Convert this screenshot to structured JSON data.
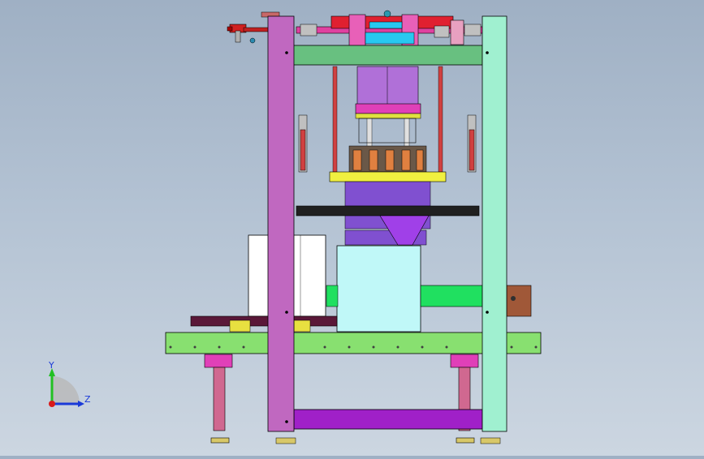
{
  "view": {
    "triad": {
      "y_label": "Y",
      "z_label": "Z",
      "y_color": "#22c022",
      "z_color": "#1a3ad8",
      "origin_color": "#d81a1a"
    }
  },
  "palette": {
    "left_column": "#c068c0",
    "right_column": "#a0f0d0",
    "top_beam": "#68c080",
    "conveyor": "#88e070",
    "base_plate": "#a020c8",
    "leg": "#d06890",
    "leg_cap": "#e040b8",
    "hopper": "#a040e8",
    "cyan_box": "#c0f8f8",
    "yellow_plate": "#f0f040",
    "brown_block": "#a05838",
    "mold_block": "#b070d8"
  }
}
